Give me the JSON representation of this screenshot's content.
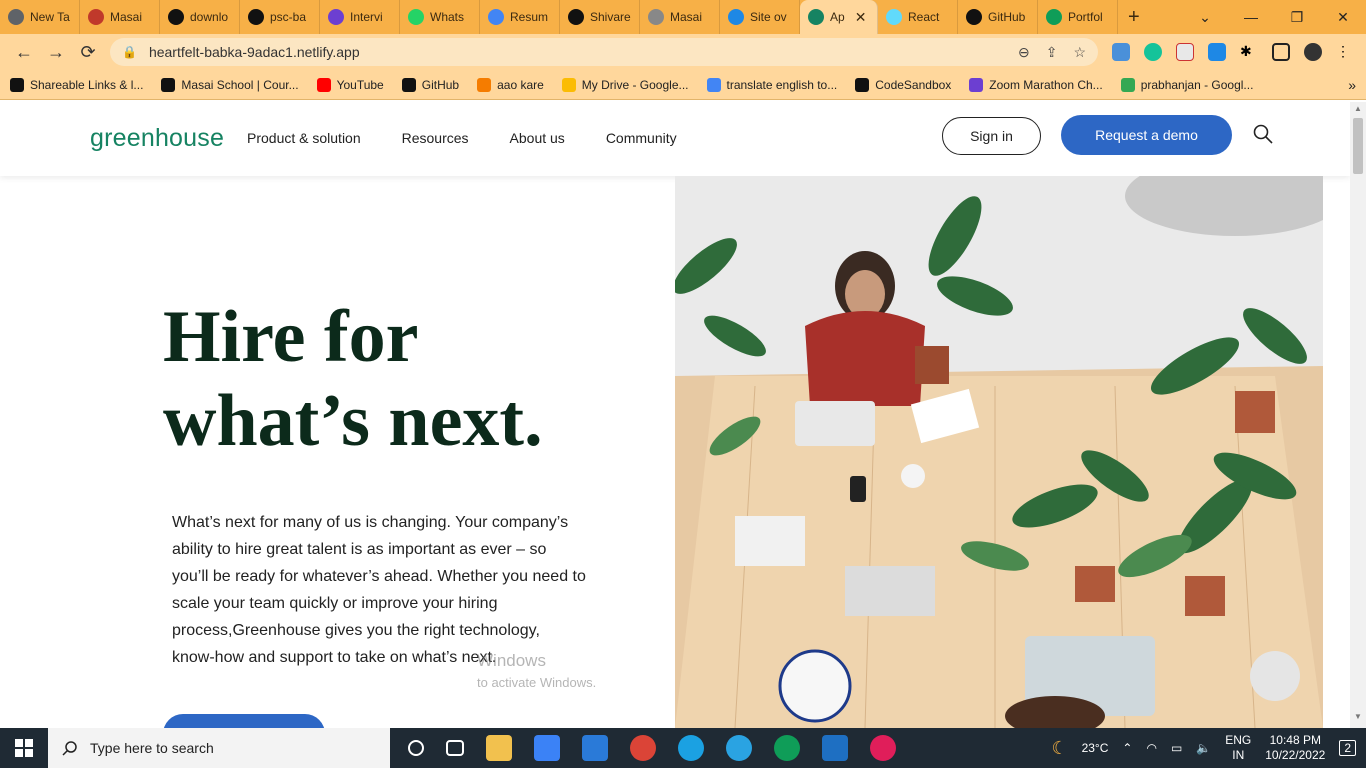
{
  "browser": {
    "tabs": [
      {
        "label": "New Ta",
        "color": "#5f6368"
      },
      {
        "label": "Masai",
        "color": "#c0392b"
      },
      {
        "label": "downlo",
        "color": "#111"
      },
      {
        "label": "psc-ba",
        "color": "#111"
      },
      {
        "label": "Intervi",
        "color": "#6c3fd1"
      },
      {
        "label": "Whats",
        "color": "#25d366"
      },
      {
        "label": "Resum",
        "color": "#4285f4"
      },
      {
        "label": "Shivare",
        "color": "#111"
      },
      {
        "label": "Masai",
        "color": "#888"
      },
      {
        "label": "Site ov",
        "color": "#1e88e5"
      },
      {
        "label": "Ap",
        "color": "#168362",
        "active": true
      },
      {
        "label": "React",
        "color": "#61dafb"
      },
      {
        "label": "GitHub",
        "color": "#111"
      },
      {
        "label": "Portfol",
        "color": "#0f9d58"
      }
    ],
    "url": "heartfelt-babka-9adac1.netlify.app",
    "bookmarks": [
      {
        "label": "Shareable Links & l...",
        "color": "#111"
      },
      {
        "label": "Masai School | Cour...",
        "color": "#111"
      },
      {
        "label": "YouTube",
        "color": "#ff0000"
      },
      {
        "label": "GitHub",
        "color": "#111"
      },
      {
        "label": "aao kare",
        "color": "#f57c00"
      },
      {
        "label": "My Drive - Google...",
        "color": "#fbbc04"
      },
      {
        "label": "translate english to...",
        "color": "#4285f4"
      },
      {
        "label": "CodeSandbox",
        "color": "#111"
      },
      {
        "label": "Zoom Marathon Ch...",
        "color": "#6c3fd1"
      },
      {
        "label": "prabhanjan - Googl...",
        "color": "#34a853"
      }
    ]
  },
  "site": {
    "logo": "greenhouse",
    "nav": [
      "Product & solution",
      "Resources",
      "About us",
      "Community"
    ],
    "sign_in": "Sign in",
    "request_demo": "Request a demo",
    "hero_title_line1": "Hire for",
    "hero_title_line2": "what’s next.",
    "hero_copy": "What’s next for many of us is changing. Your company’s ability to hire great talent is as important as ever – so you’ll be ready for whatever’s ahead. Whether you need to scale your team quickly or improve your hiring process,Greenhouse gives you the right technology, know-how and support to take on what’s next."
  },
  "watermark": {
    "line1": "Windows",
    "line2": "to activate Windows."
  },
  "taskbar": {
    "search_placeholder": "Type here to search",
    "temperature": "23°C",
    "lang_line1": "ENG",
    "lang_line2": "IN",
    "time": "10:48 PM",
    "date": "10/22/2022",
    "notifications": "2"
  },
  "colors": {
    "brand_green": "#168362",
    "primary_blue": "#2d67c5",
    "chrome_orange": "#f7b047"
  }
}
